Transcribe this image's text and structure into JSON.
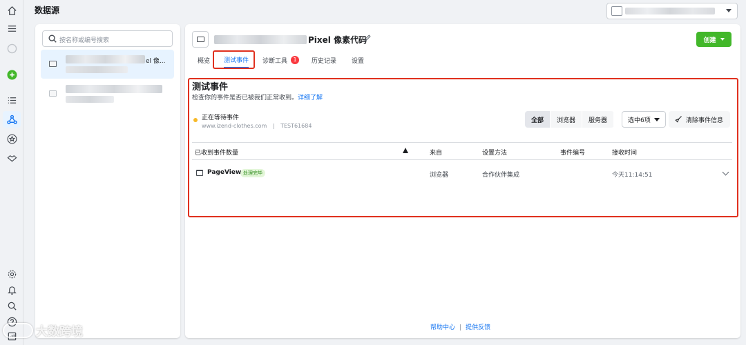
{
  "header": {
    "title": "数据源"
  },
  "sidebar": {
    "search_placeholder": "按名称或编号搜索",
    "items": [
      {
        "suffix": "el 像..."
      }
    ]
  },
  "pixel": {
    "name": "Pixel 像素代码",
    "create_label": "创建"
  },
  "tabs": [
    {
      "label": "概览"
    },
    {
      "label": "测试事件"
    },
    {
      "label": "诊断工具",
      "badge": "1"
    },
    {
      "label": "历史记录"
    },
    {
      "label": "设置"
    }
  ],
  "test_events": {
    "title": "测试事件",
    "subtitle": "检查你的事件是否已被我们正常收到。",
    "learn_more": "详细了解",
    "status_title": "正在等待事件",
    "status_url": "www.izend-clothes.com",
    "status_sep": "|",
    "status_code": "TEST61684",
    "filters": [
      "全部",
      "浏览器",
      "服务器"
    ],
    "dropdown_value": "选中6项",
    "clear_label": "清除事件信息"
  },
  "table": {
    "columns": [
      "已收到事件数量",
      "来自",
      "设置方法",
      "事件编号",
      "接收时间"
    ],
    "rows": [
      {
        "event": "PageView",
        "status": "处理完毕",
        "source": "浏览器",
        "method": "合作伙伴集成",
        "event_id": "",
        "time": "今天11:14:51"
      }
    ]
  },
  "footer": {
    "help": "帮助中心",
    "feedback": "提供反馈",
    "sep": "|"
  },
  "watermark": {
    "text": "大数跨境"
  },
  "colors": {
    "accent": "#1877f2",
    "create": "#42b72a",
    "highlight": "#e0301e",
    "pending": "#f7b928"
  }
}
